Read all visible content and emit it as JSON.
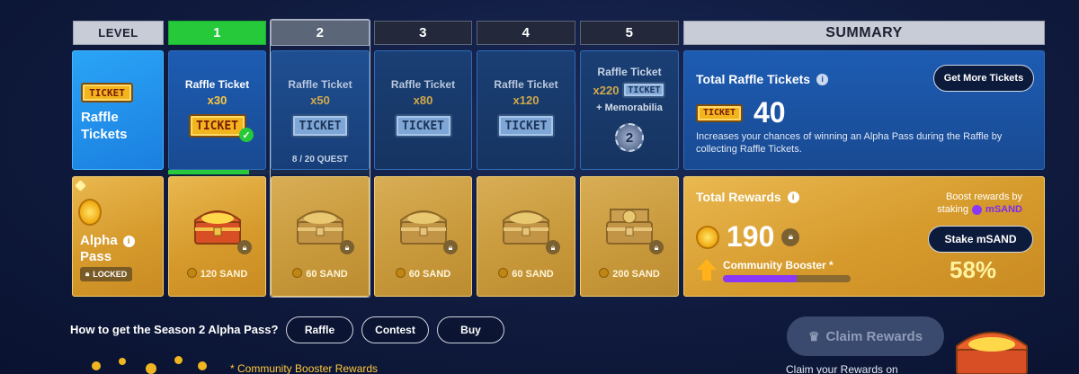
{
  "header": {
    "level_label": "LEVEL",
    "levels": [
      "1",
      "2",
      "3",
      "4",
      "5"
    ],
    "summary_label": "SUMMARY"
  },
  "raffle_row": {
    "row_label_line1": "Raffle",
    "row_label_line2": "Tickets",
    "ticket_word": "TICKET",
    "levels": [
      {
        "title": "Raffle Ticket",
        "amount": "x30"
      },
      {
        "title": "Raffle Ticket",
        "amount": "x50"
      },
      {
        "title": "Raffle Ticket",
        "amount": "x80"
      },
      {
        "title": "Raffle Ticket",
        "amount": "x120"
      },
      {
        "title": "Raffle Ticket",
        "amount": "x220",
        "extra": "+ Memorabilia"
      }
    ],
    "quest_progress_text": "8 / 20 QUEST",
    "quest_progress_fraction": 0.4,
    "summary": {
      "title": "Total Raffle Tickets",
      "count": "40",
      "button_label": "Get More Tickets",
      "description": "Increases your chances of winning an Alpha Pass during the Raffle by collecting Raffle Tickets."
    }
  },
  "alpha_row": {
    "row_label_line1": "Alpha",
    "row_label_line2": "Pass",
    "locked_label": "LOCKED",
    "rewards": [
      "120 SAND",
      "60 SAND",
      "60 SAND",
      "60 SAND",
      "200 SAND"
    ],
    "summary": {
      "title": "Total Rewards",
      "amount": "190",
      "boost_line1": "Boost rewards by",
      "boost_line2": "staking",
      "token": "mSAND",
      "stake_button": "Stake mSAND",
      "booster_label": "Community Booster *",
      "booster_percent": "58%",
      "booster_fraction": 0.58
    }
  },
  "footer": {
    "question": "How to get the Season 2 Alpha Pass?",
    "options": [
      "Raffle",
      "Contest",
      "Buy"
    ],
    "claim_button": "Claim Rewards",
    "claim_note": "Claim your Rewards on",
    "booster_note": "* Community Booster Rewards"
  },
  "colors": {
    "accent_green": "#25c93a",
    "gold_text": "#ffc93a",
    "booster_purple": "#8a38f5"
  }
}
